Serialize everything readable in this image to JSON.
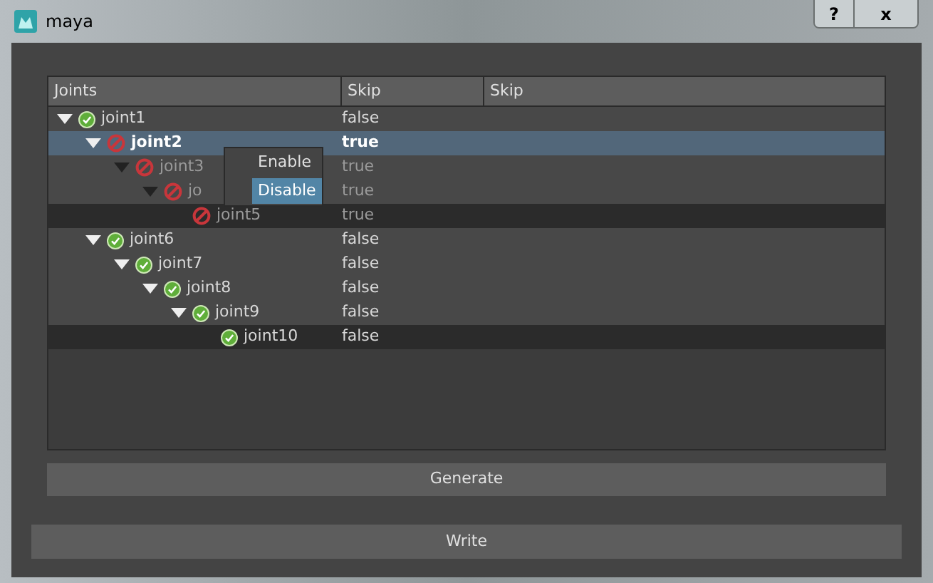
{
  "window": {
    "title": "maya",
    "buttons": [
      "?",
      "x"
    ]
  },
  "table": {
    "columns": [
      "Joints",
      "Skip",
      "Skip"
    ],
    "rows": [
      {
        "name": "joint1",
        "enabled": true,
        "skip": "false",
        "selected": false,
        "faded": false,
        "shaded": false,
        "expanded": true,
        "children": [
          {
            "name": "joint2",
            "enabled": false,
            "skip": "true",
            "selected": true,
            "faded": false,
            "shaded": false,
            "expanded": true,
            "children": [
              {
                "name": "joint3",
                "enabled": false,
                "skip": "true",
                "selected": false,
                "faded": true,
                "shaded": false,
                "expanded": true,
                "children": [
                  {
                    "name": "jo",
                    "enabled": false,
                    "skip": "true",
                    "selected": false,
                    "faded": true,
                    "shaded": false,
                    "expanded": true,
                    "children": [
                      {
                        "name": "joint5",
                        "enabled": false,
                        "skip": "true",
                        "selected": false,
                        "faded": true,
                        "shaded": true
                      }
                    ]
                  }
                ]
              }
            ]
          },
          {
            "name": "joint6",
            "enabled": true,
            "skip": "false",
            "selected": false,
            "faded": false,
            "shaded": false,
            "expanded": true,
            "children": [
              {
                "name": "joint7",
                "enabled": true,
                "skip": "false",
                "selected": false,
                "faded": false,
                "shaded": false,
                "expanded": true,
                "children": [
                  {
                    "name": "joint8",
                    "enabled": true,
                    "skip": "false",
                    "selected": false,
                    "faded": false,
                    "shaded": false,
                    "expanded": true,
                    "children": [
                      {
                        "name": "joint9",
                        "enabled": true,
                        "skip": "false",
                        "selected": false,
                        "faded": false,
                        "shaded": false,
                        "expanded": true,
                        "children": [
                          {
                            "name": "joint10",
                            "enabled": true,
                            "skip": "false",
                            "selected": false,
                            "faded": false,
                            "shaded": true
                          }
                        ]
                      }
                    ]
                  }
                ]
              }
            ]
          }
        ]
      }
    ]
  },
  "context_menu": [
    {
      "label": "Enable",
      "selected": false
    },
    {
      "label": "Disable",
      "selected": true
    }
  ],
  "buttons": {
    "generate": "Generate",
    "write": "Write"
  }
}
